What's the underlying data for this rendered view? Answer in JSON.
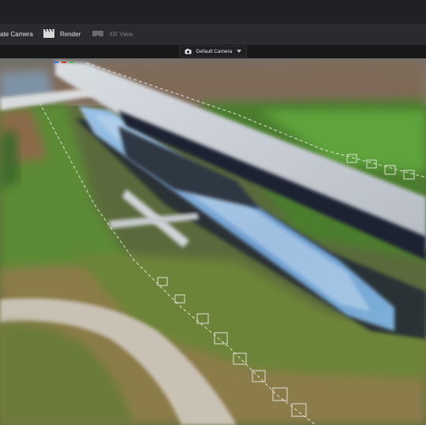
{
  "toolbar": {
    "create_camera_label": "ate Camera",
    "render_label": "Render",
    "xr_view_label": "XR View"
  },
  "camera_selector": {
    "selected": "Default Camera"
  },
  "icons": {
    "render": "clapperboard-icon",
    "xr_view": "vr-headset-icon",
    "camera": "camera-icon",
    "dropdown": "triangle-down-icon"
  },
  "colors": {
    "toolbar_bg": "#2a2b2e",
    "titlebar_bg": "#202124",
    "camera_bar_bg": "#17181a",
    "disabled_text": "#7a7b7e"
  }
}
